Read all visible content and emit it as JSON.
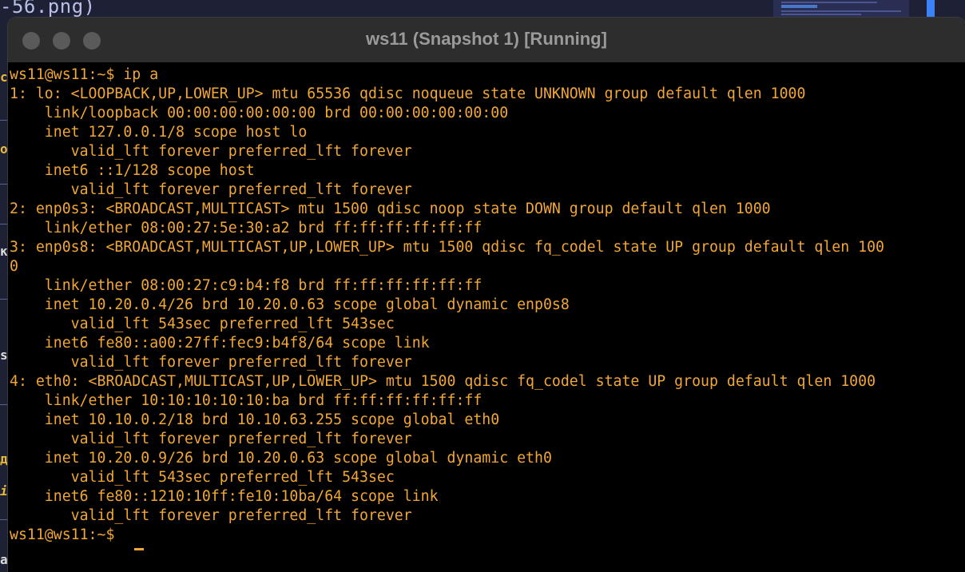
{
  "background": {
    "top_text": "-56.png)",
    "left_margin_marks": [
      "c",
      "o",
      "к",
      "s",
      "д",
      "i",
      "a"
    ]
  },
  "window": {
    "title": "ws11 (Snapshot 1) [Running]"
  },
  "terminal": {
    "text_color": "#f2a633",
    "background": "#000000",
    "lines": [
      "ws11@ws11:~$ ip a",
      "1: lo: <LOOPBACK,UP,LOWER_UP> mtu 65536 qdisc noqueue state UNKNOWN group default qlen 1000",
      "    link/loopback 00:00:00:00:00:00 brd 00:00:00:00:00:00",
      "    inet 127.0.0.1/8 scope host lo",
      "       valid_lft forever preferred_lft forever",
      "    inet6 ::1/128 scope host",
      "       valid_lft forever preferred_lft forever",
      "2: enp0s3: <BROADCAST,MULTICAST> mtu 1500 qdisc noop state DOWN group default qlen 1000",
      "    link/ether 08:00:27:5e:30:a2 brd ff:ff:ff:ff:ff:ff",
      "3: enp0s8: <BROADCAST,MULTICAST,UP,LOWER_UP> mtu 1500 qdisc fq_codel state UP group default qlen 100",
      "0",
      "    link/ether 08:00:27:c9:b4:f8 brd ff:ff:ff:ff:ff:ff",
      "    inet 10.20.0.4/26 brd 10.20.0.63 scope global dynamic enp0s8",
      "       valid_lft 543sec preferred_lft 543sec",
      "    inet6 fe80::a00:27ff:fec9:b4f8/64 scope link",
      "       valid_lft forever preferred_lft forever",
      "4: eth0: <BROADCAST,MULTICAST,UP,LOWER_UP> mtu 1500 qdisc fq_codel state UP group default qlen 1000",
      "    link/ether 10:10:10:10:10:ba brd ff:ff:ff:ff:ff:ff",
      "    inet 10.10.0.2/18 brd 10.10.63.255 scope global eth0",
      "       valid_lft forever preferred_lft forever",
      "    inet 10.20.0.9/26 brd 10.20.0.63 scope global dynamic eth0",
      "       valid_lft 543sec preferred_lft 543sec",
      "    inet6 fe80::1210:10ff:fe10:10ba/64 scope link",
      "       valid_lft forever preferred_lft forever",
      "ws11@ws11:~$ "
    ]
  }
}
